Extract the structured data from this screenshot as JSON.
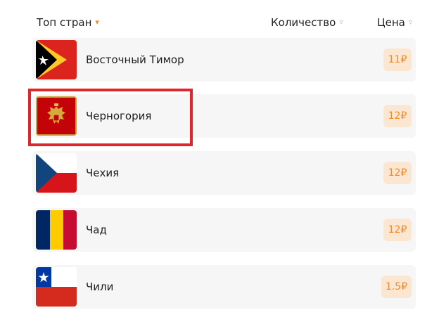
{
  "header": {
    "name_label": "Топ стран",
    "name_sort_icon": "▾",
    "count_label": "Количество",
    "count_sort_icon": "▿",
    "price_label": "Цена",
    "price_sort_icon": "▿"
  },
  "rows": [
    {
      "name": "Восточный Тимор",
      "price": "11₽",
      "flag": "east-timor-flag-icon"
    },
    {
      "name": "Черногория",
      "price": "12₽",
      "flag": "montenegro-flag-icon"
    },
    {
      "name": "Чехия",
      "price": "12₽",
      "flag": "czech-flag-icon"
    },
    {
      "name": "Чад",
      "price": "12₽",
      "flag": "chad-flag-icon"
    },
    {
      "name": "Чили",
      "price": "1.5₽",
      "flag": "chile-flag-icon"
    }
  ],
  "colors": {
    "accent": "#f08a2c",
    "badge_bg": "#fbe6d2",
    "row_bg": "#f6f6f6",
    "highlight": "#e0262d"
  }
}
